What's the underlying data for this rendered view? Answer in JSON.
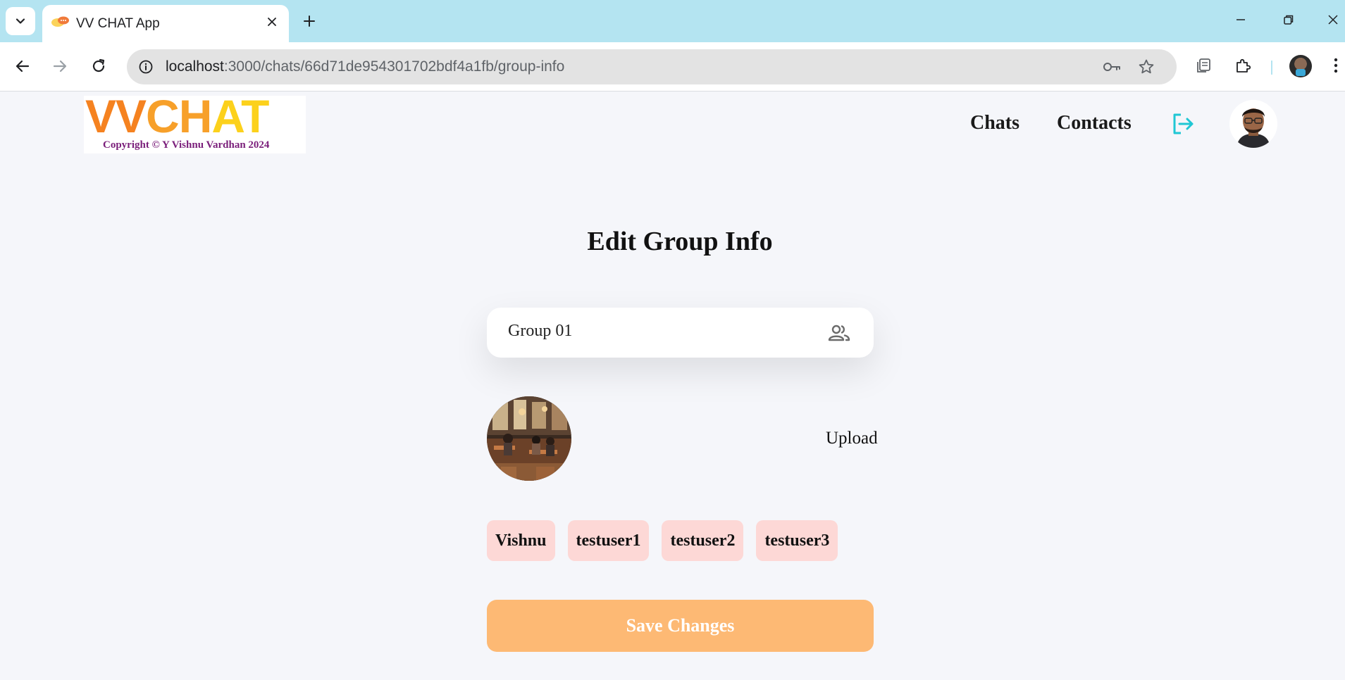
{
  "browser": {
    "tab_title": "VV CHAT App",
    "url_host": "localhost",
    "url_path": ":3000/chats/66d71de954301702bdf4a1fb/group-info"
  },
  "header": {
    "logo_parts": [
      "VV",
      "CH",
      "AT"
    ],
    "logo_copyright": "Copyright © Y Vishnu Vardhan 2024",
    "nav_chats": "Chats",
    "nav_contacts": "Contacts"
  },
  "main": {
    "title": "Edit Group Info",
    "group_name_value": "Group 01",
    "upload_label": "Upload",
    "members": [
      "Vishnu",
      "testuser1",
      "testuser2",
      "testuser3"
    ],
    "save_label": "Save Changes"
  },
  "colors": {
    "accent": "#fdb974",
    "chip": "#fdd8d6",
    "logout_icon": "#1fc7d4"
  }
}
